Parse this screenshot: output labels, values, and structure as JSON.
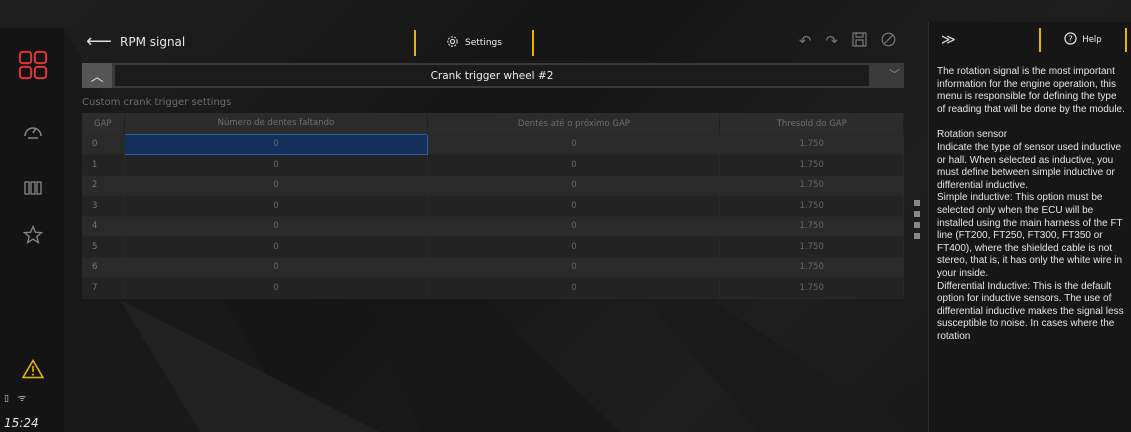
{
  "header": {
    "title": "RPM signal",
    "settings_label": "Settings"
  },
  "sidebar": {
    "time": "15:24"
  },
  "selector": {
    "value": "Crank trigger wheel #2"
  },
  "section": {
    "subtitle": "Custom crank trigger settings"
  },
  "table": {
    "columns": [
      "GAP",
      "Número de dentes faltando",
      "Dentes até o próximo GAP",
      "Thresold do GAP"
    ],
    "rows": [
      {
        "gap": "0",
        "missing": "0",
        "next": "0",
        "threshold": "1.750"
      },
      {
        "gap": "1",
        "missing": "0",
        "next": "0",
        "threshold": "1.750"
      },
      {
        "gap": "2",
        "missing": "0",
        "next": "0",
        "threshold": "1.750"
      },
      {
        "gap": "3",
        "missing": "0",
        "next": "0",
        "threshold": "1.750"
      },
      {
        "gap": "4",
        "missing": "0",
        "next": "0",
        "threshold": "1.750"
      },
      {
        "gap": "5",
        "missing": "0",
        "next": "0",
        "threshold": "1.750"
      },
      {
        "gap": "6",
        "missing": "0",
        "next": "0",
        "threshold": "1.750"
      },
      {
        "gap": "7",
        "missing": "0",
        "next": "0",
        "threshold": "1.750"
      }
    ]
  },
  "help": {
    "label": "Help",
    "intro": "The rotation signal is the most important information for the engine operation, this menu is responsible for defining the type of reading that will be done by the module.",
    "heading": "Rotation sensor",
    "body": "Indicate the type of sensor used inductive or hall. When selected as inductive, you must define between simple inductive or differential inductive.",
    "simple": "Simple inductive: This option must be selected only when the ECU will be installed using the main harness of the FT line (FT200, FT250, FT300, FT350 or FT400), where the shielded cable is not stereo, that is, it has only the white wire in your inside.",
    "differential": "Differential Inductive: This is the default option for inductive sensors. The use of differential inductive makes the signal less susceptible to noise. In cases where the rotation"
  },
  "colors": {
    "accent": "#e8b400",
    "sidebar_brand": "#e0343a",
    "warning": "#e8b400",
    "selected_cell": "#12305a"
  }
}
